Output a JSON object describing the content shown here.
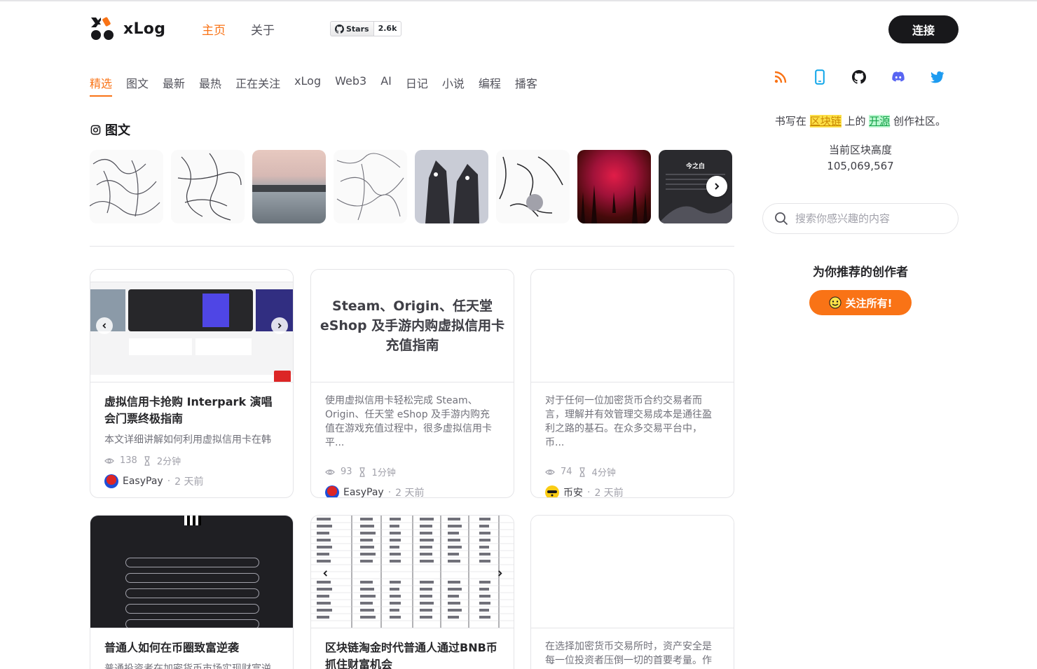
{
  "header": {
    "logo_text": "xLog",
    "nav": [
      {
        "label": "主页",
        "active": true
      },
      {
        "label": "关于",
        "active": false
      }
    ],
    "github_stars": {
      "label": "Stars",
      "count": "2.6k"
    },
    "connect_label": "连接"
  },
  "categories": [
    {
      "label": "精选",
      "active": true
    },
    {
      "label": "图文"
    },
    {
      "label": "最新"
    },
    {
      "label": "最热"
    },
    {
      "label": "正在关注"
    },
    {
      "label": "xLog"
    },
    {
      "label": "Web3"
    },
    {
      "label": "AI"
    },
    {
      "label": "日记"
    },
    {
      "label": "小说"
    },
    {
      "label": "编程"
    },
    {
      "label": "播客"
    }
  ],
  "gallery": {
    "title": "图文",
    "thumb_text_8": "今之白"
  },
  "cards": [
    {
      "cover_type": "image",
      "title": "虚拟信用卡抢购 Interpark 演唱会门票终极指南",
      "excerpt": "本文详细讲解如何利用虚拟信用卡在韩",
      "views": "138",
      "read_time": "2分钟",
      "author": "EasyPay",
      "time": "2 天前"
    },
    {
      "cover_type": "text",
      "cover_text": "Steam、Origin、任天堂 eShop 及手游内购虚拟信用卡充值指南",
      "excerpt": "使用虚拟信用卡轻松完成 Steam、Origin、任天堂 eShop 及手游内购充值在游戏充值过程中，很多虚拟信用卡平...",
      "views": "93",
      "read_time": "1分钟",
      "author": "EasyPay",
      "time": "2 天前"
    },
    {
      "cover_type": "blank",
      "excerpt": "对于任何一位加密货币合约交易者而言，理解并有效管理交易成本是通往盈利之路的基石。在众多交易平台中，币...",
      "views": "74",
      "read_time": "4分钟",
      "author": "币安",
      "time": "2 天前"
    },
    {
      "cover_type": "image",
      "title": "普通人如何在币圈致富逆袭",
      "excerpt": "普通投资者在加密货币市场实现财富逆"
    },
    {
      "cover_type": "image",
      "title": "区块链淘金时代普通人通过BNB币抓住财富机会"
    },
    {
      "cover_type": "blank",
      "excerpt": "在选择加密货币交易所时，资产安全是每一位投资者压倒一切的首要考量。作"
    }
  ],
  "sidebar": {
    "tagline_pre": "书写在 ",
    "tagline_hl1": "区块链",
    "tagline_mid": " 上的 ",
    "tagline_hl2": "开源",
    "tagline_post": " 创作社区。",
    "block_label": "当前区块高度",
    "block_height": "105,069,567",
    "search_placeholder": "搜索你感兴趣的内容",
    "recommend_title": "为你推荐的创作者",
    "follow_all_label": "关注所有!"
  },
  "colors": {
    "accent": "#f97316",
    "dark": "#18181b",
    "discord": "#5865f2",
    "twitter": "#1d9bf0",
    "mobile": "#0ea5e9"
  }
}
